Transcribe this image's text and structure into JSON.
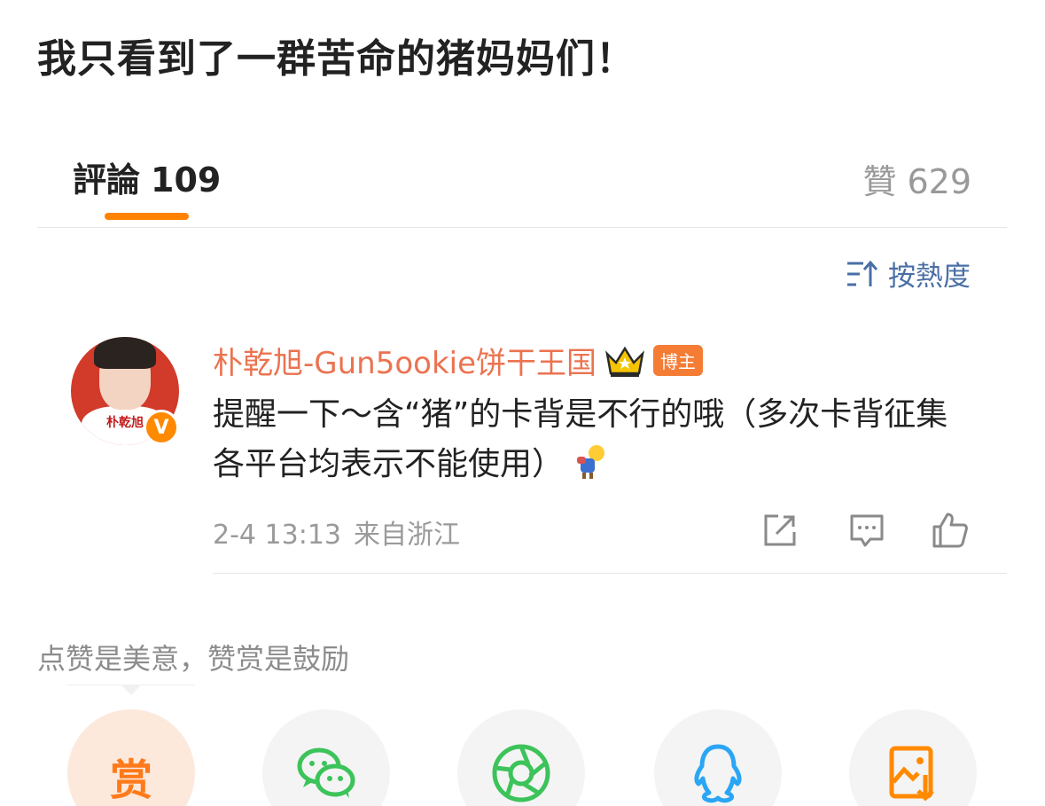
{
  "post": {
    "title": "我只看到了一群苦命的猪妈妈们！"
  },
  "tabs": {
    "comments_label": "評論",
    "comments_count": "109",
    "likes_label": "贊",
    "likes_count": "629"
  },
  "sort": {
    "label": "按熱度",
    "icon": "sort-icon"
  },
  "comment": {
    "username": "朴乾旭-Gun5ookie饼干王国",
    "badge": "博主",
    "crown_icon": "crown-icon",
    "avatar_caption": "朴乾旭",
    "verified_mark": "V",
    "text": "提醒一下～含“猪”的卡背是不行的哦（多次卡背征集各平台均表示不能使用）",
    "date": "2-4 13:13",
    "location": "来自浙江"
  },
  "actions": {
    "share_icon": "share-icon",
    "comment_icon": "comment-icon",
    "like_icon": "like-icon"
  },
  "reward": {
    "note": "点赞是美意，赞赏是鼓励",
    "reward_label": "赏"
  },
  "share_targets": [
    "wechat-icon",
    "moments-icon",
    "qq-icon",
    "save-image-icon"
  ],
  "colors": {
    "accent_orange": "#ff8200",
    "username": "#eb7350",
    "sort_blue": "#4a6fa5",
    "wechat_green": "#3cc35a",
    "qq_blue": "#2aa6f5",
    "save_orange": "#ff8a00"
  }
}
